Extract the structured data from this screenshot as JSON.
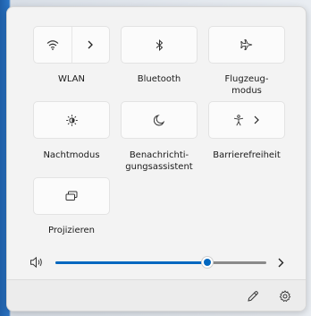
{
  "tiles": [
    {
      "label": "WLAN",
      "icon": "wifi-icon",
      "split": true
    },
    {
      "label": "Bluetooth",
      "icon": "bluetooth-icon",
      "split": false
    },
    {
      "label": "Flugzeug-\nmodus",
      "icon": "airplane-icon",
      "split": false
    },
    {
      "label": "Nachtmodus",
      "icon": "night-light-icon",
      "split": false
    },
    {
      "label": "Benachrichti-\ngungsassistent",
      "icon": "focus-assist-icon",
      "split": false
    },
    {
      "label": "Barrierefreiheit",
      "icon": "accessibility-icon",
      "split": false,
      "chevron": true
    },
    {
      "label": "Projizieren",
      "icon": "project-icon",
      "split": false
    }
  ],
  "volume": {
    "icon": "speaker-icon",
    "level": 0.72
  },
  "footer": {
    "edit_icon": "pencil-icon",
    "settings_icon": "gear-icon"
  },
  "colors": {
    "accent": "#0067c0",
    "panel": "#f3f3f3",
    "tile": "#fbfbfb"
  }
}
